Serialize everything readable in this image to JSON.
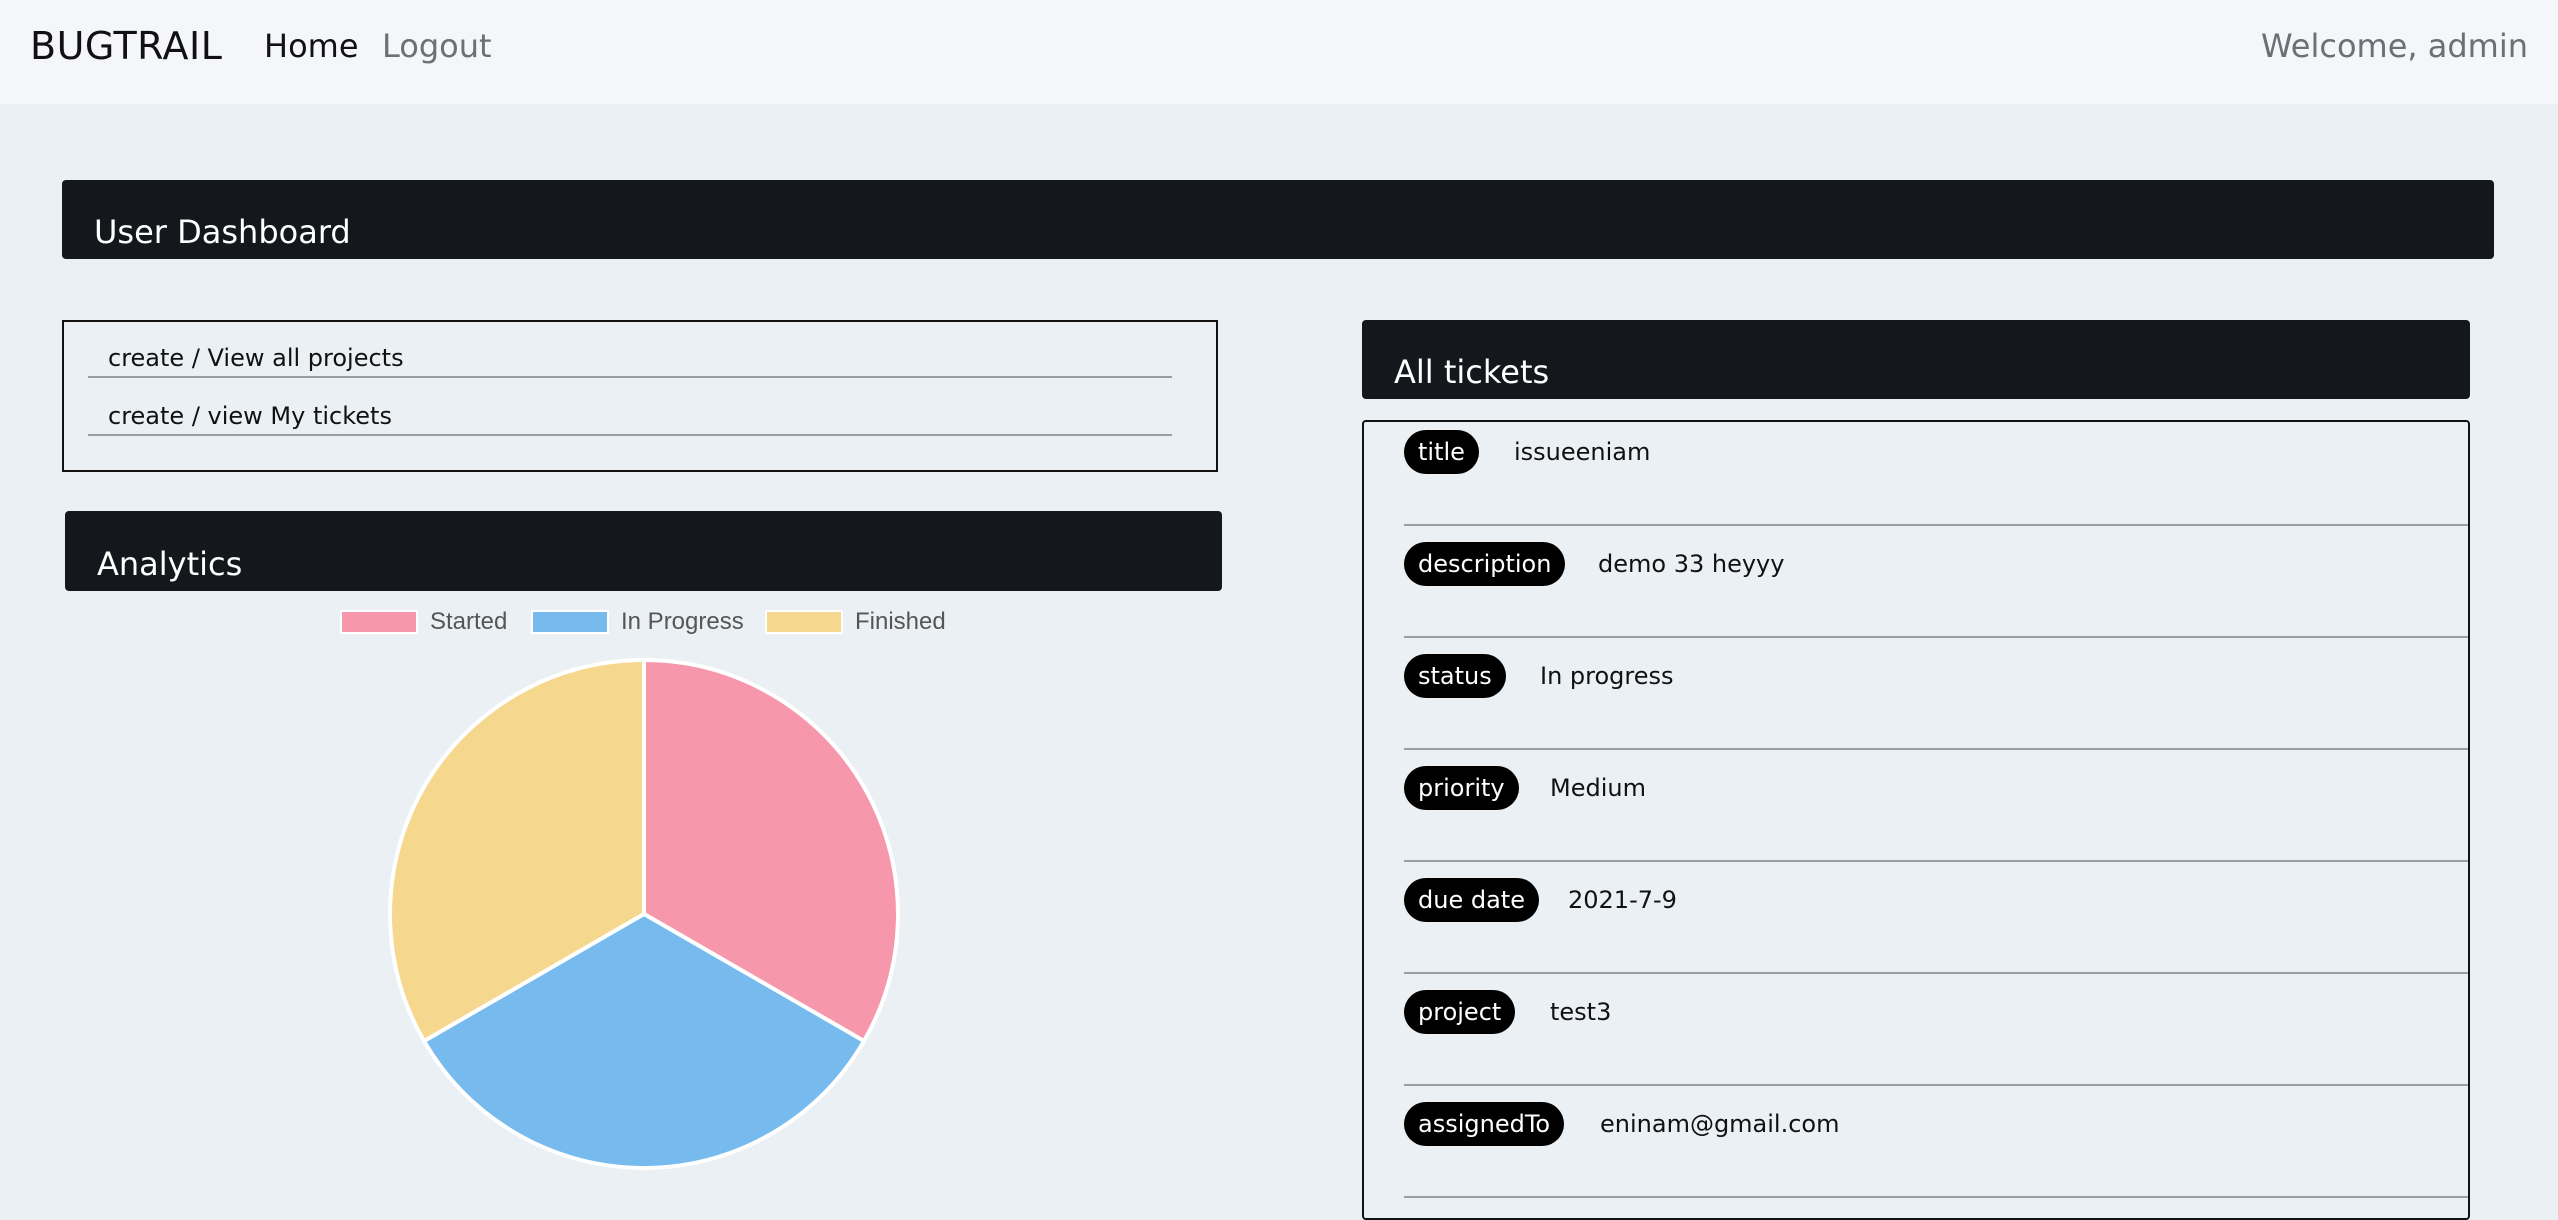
{
  "navbar": {
    "brand": "BUGTRAIL",
    "home_label": "Home",
    "logout_label": "Logout",
    "welcome_text": "Welcome, admin"
  },
  "dashboard": {
    "title": "User Dashboard"
  },
  "links": [
    {
      "label": "create / View all projects"
    },
    {
      "label": "create / view My tickets"
    }
  ],
  "analytics": {
    "title": "Analytics"
  },
  "chart_data": {
    "type": "pie",
    "categories": [
      "Started",
      "In Progress",
      "Finished"
    ],
    "values": [
      1,
      1,
      1
    ],
    "colors": [
      "#f797ac",
      "#77bbee",
      "#f5d78d"
    ],
    "legend_position": "top"
  },
  "tickets": {
    "title": "All tickets",
    "fields": [
      {
        "label": "title",
        "value": "issueeniam"
      },
      {
        "label": "description",
        "value": "demo 33 heyyy"
      },
      {
        "label": "status",
        "value": "In progress"
      },
      {
        "label": "priority",
        "value": "Medium"
      },
      {
        "label": "due date",
        "value": "2021-7-9"
      },
      {
        "label": "project",
        "value": "test3"
      },
      {
        "label": "assignedTo",
        "value": "eninam@gmail.com"
      }
    ]
  }
}
